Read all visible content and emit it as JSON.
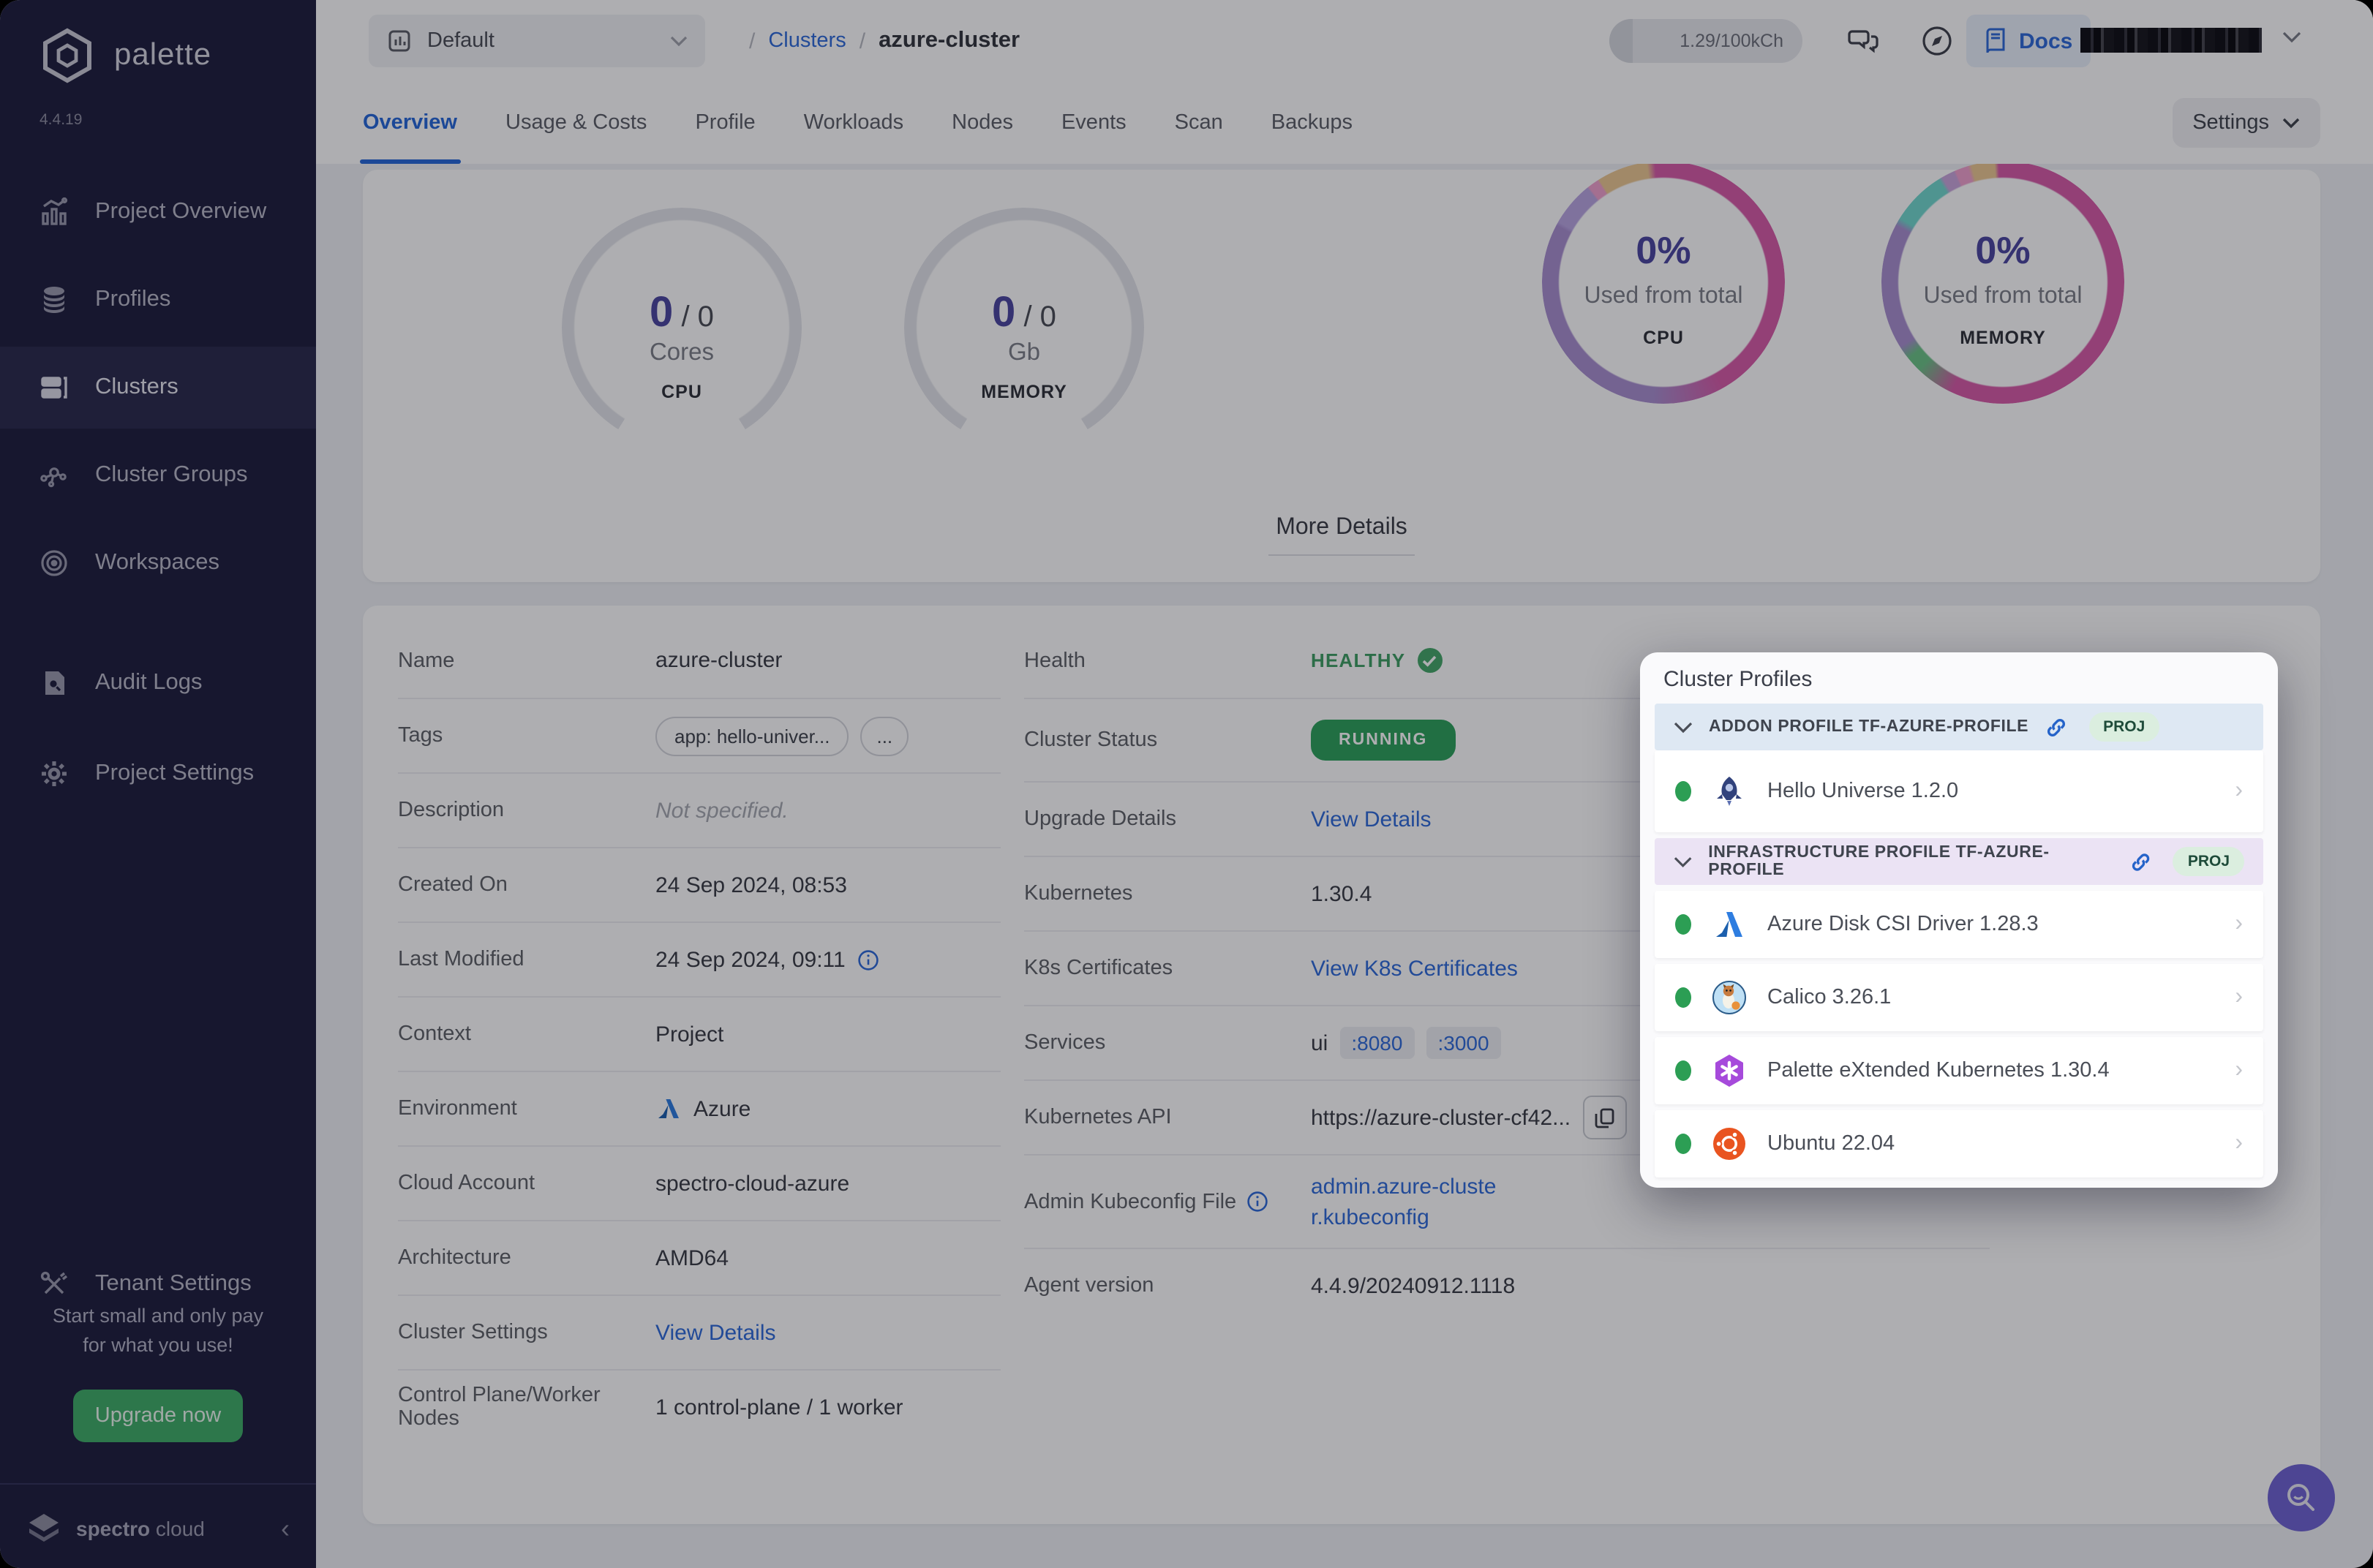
{
  "theme": {
    "accent_blue": "#2F6BD9",
    "green_button": "#3FAE68",
    "status_green": "#2DA15B",
    "health_green": "#3E9E63",
    "indigo_value": "#4B46A0",
    "fab_indigo": "#6F63D2",
    "sidebar_bg": "#1F1F3E",
    "donut_magenta": "#D75BA8",
    "donut_purple": "#A98FD0",
    "donut_tan": "#ECC893",
    "donut_teal": "#72D8CE",
    "donut_green": "#6CC487",
    "donut_pink": "#F0A1CE"
  },
  "sidebar": {
    "logo": "palette",
    "version": "4.4.19",
    "items": [
      {
        "label": "Project Overview"
      },
      {
        "label": "Profiles"
      },
      {
        "label": "Clusters"
      },
      {
        "label": "Cluster Groups"
      },
      {
        "label": "Workspaces"
      },
      {
        "label": "Audit Logs"
      },
      {
        "label": "Project Settings"
      },
      {
        "label": "Tenant Settings"
      }
    ],
    "active_item": "Clusters",
    "promo_line1": "Start small and only pay",
    "promo_line2": "for what you use!",
    "upgrade_label": "Upgrade now",
    "brand_bold": "spectro",
    "brand_light": " cloud",
    "collapse_glyph": "‹"
  },
  "topbar": {
    "project_selector": "Default",
    "breadcrumb_sep1": "/",
    "breadcrumb_link": "Clusters",
    "breadcrumb_sep2": "/",
    "breadcrumb_current": "azure-cluster",
    "usage_pill": "1.29/100kCh",
    "docs_label": "Docs"
  },
  "tabs": {
    "active": "Overview",
    "items": [
      {
        "label": "Overview"
      },
      {
        "label": "Usage & Costs"
      },
      {
        "label": "Profile"
      },
      {
        "label": "Workloads"
      },
      {
        "label": "Nodes"
      },
      {
        "label": "Events"
      },
      {
        "label": "Scan"
      },
      {
        "label": "Backups"
      }
    ],
    "settings_button": "Settings"
  },
  "metrics": {
    "cpu_gauge": {
      "value": "0",
      "sep": "/ 0",
      "unit": "Cores",
      "caption": "CPU"
    },
    "memory_gauge": {
      "value": "0",
      "sep": "/ 0",
      "unit": "Gb",
      "caption": "MEMORY"
    },
    "cpu_donut": {
      "pct": "0%",
      "label": "Used from total",
      "caption": "CPU"
    },
    "memory_donut": {
      "pct": "0%",
      "label": "Used from total",
      "caption": "MEMORY"
    },
    "more_details": "More Details"
  },
  "chart_data": [
    {
      "type": "gauge",
      "title": "CPU",
      "value": 0,
      "total": 0,
      "unit": "Cores",
      "center_text": "0 / 0"
    },
    {
      "type": "gauge",
      "title": "MEMORY",
      "value": 0,
      "total": 0,
      "unit": "Gb",
      "center_text": "0 / 0"
    },
    {
      "type": "pie",
      "title": "CPU",
      "center_label": "0%",
      "sub_label": "Used from total",
      "series": [
        {
          "name": "capacity-segments",
          "values": [
            50,
            38,
            2,
            1,
            7,
            2
          ]
        }
      ],
      "categories": [
        "magenta",
        "purple",
        "lavender",
        "pink",
        "tan",
        "magenta"
      ],
      "legend": "none"
    },
    {
      "type": "pie",
      "title": "MEMORY",
      "center_label": "0%",
      "sub_label": "Used from total",
      "series": [
        {
          "name": "capacity-segments",
          "values": [
            57,
            2,
            17,
            8,
            2,
            2,
            5,
            7
          ]
        }
      ],
      "categories": [
        "magenta",
        "green",
        "purple",
        "teal",
        "lavender",
        "pink",
        "tan",
        "magenta"
      ],
      "legend": "none"
    }
  ],
  "details": {
    "left": [
      {
        "label": "Name",
        "value": "azure-cluster"
      },
      {
        "label": "Tags",
        "tag1": "app: hello-univer...",
        "tag2": "..."
      },
      {
        "label": "Description",
        "value": "Not specified."
      },
      {
        "label": "Created On",
        "value": "24 Sep 2024, 08:53"
      },
      {
        "label": "Last Modified",
        "value": "24 Sep 2024, 09:11"
      },
      {
        "label": "Context",
        "value": "Project"
      },
      {
        "label": "Environment",
        "value": "Azure"
      },
      {
        "label": "Cloud Account",
        "value": "spectro-cloud-azure"
      },
      {
        "label": "Architecture",
        "value": "AMD64"
      },
      {
        "label": "Cluster Settings",
        "value": "View Details"
      },
      {
        "label": "Control Plane/Worker Nodes",
        "value": "1 control-plane / 1 worker"
      }
    ],
    "right": [
      {
        "label": "Health",
        "value": "HEALTHY"
      },
      {
        "label": "Cluster Status",
        "value": "RUNNING"
      },
      {
        "label": "Upgrade Details",
        "value": "View Details"
      },
      {
        "label": "Kubernetes",
        "value": "1.30.4"
      },
      {
        "label": "K8s Certificates",
        "value": "View K8s Certificates"
      },
      {
        "label": "Services",
        "value": "ui",
        "port1": ":8080",
        "port2": ":3000"
      },
      {
        "label": "Kubernetes API",
        "value": "https://azure-cluster-cf42..."
      },
      {
        "label": "Admin Kubeconfig File",
        "value": "admin.azure-cluster.kubeconfig"
      },
      {
        "label": "Agent version",
        "value": "4.4.9/20240912.1118"
      }
    ]
  },
  "popup": {
    "title": "Cluster Profiles",
    "sections": [
      {
        "label": "ADDON PROFILE TF-AZURE-PROFILE",
        "badge": "PROJ"
      },
      {
        "label": "INFRASTRUCTURE PROFILE TF-AZURE-PROFILE",
        "badge": "PROJ"
      }
    ],
    "rows": [
      {
        "name": "Hello Universe 1.2.0"
      },
      {
        "name": "Azure Disk CSI Driver 1.28.3"
      },
      {
        "name": "Calico 3.26.1"
      },
      {
        "name": "Palette eXtended Kubernetes 1.30.4"
      },
      {
        "name": "Ubuntu 22.04"
      }
    ],
    "row_chevron": "›",
    "section_chevron": "⌄"
  }
}
